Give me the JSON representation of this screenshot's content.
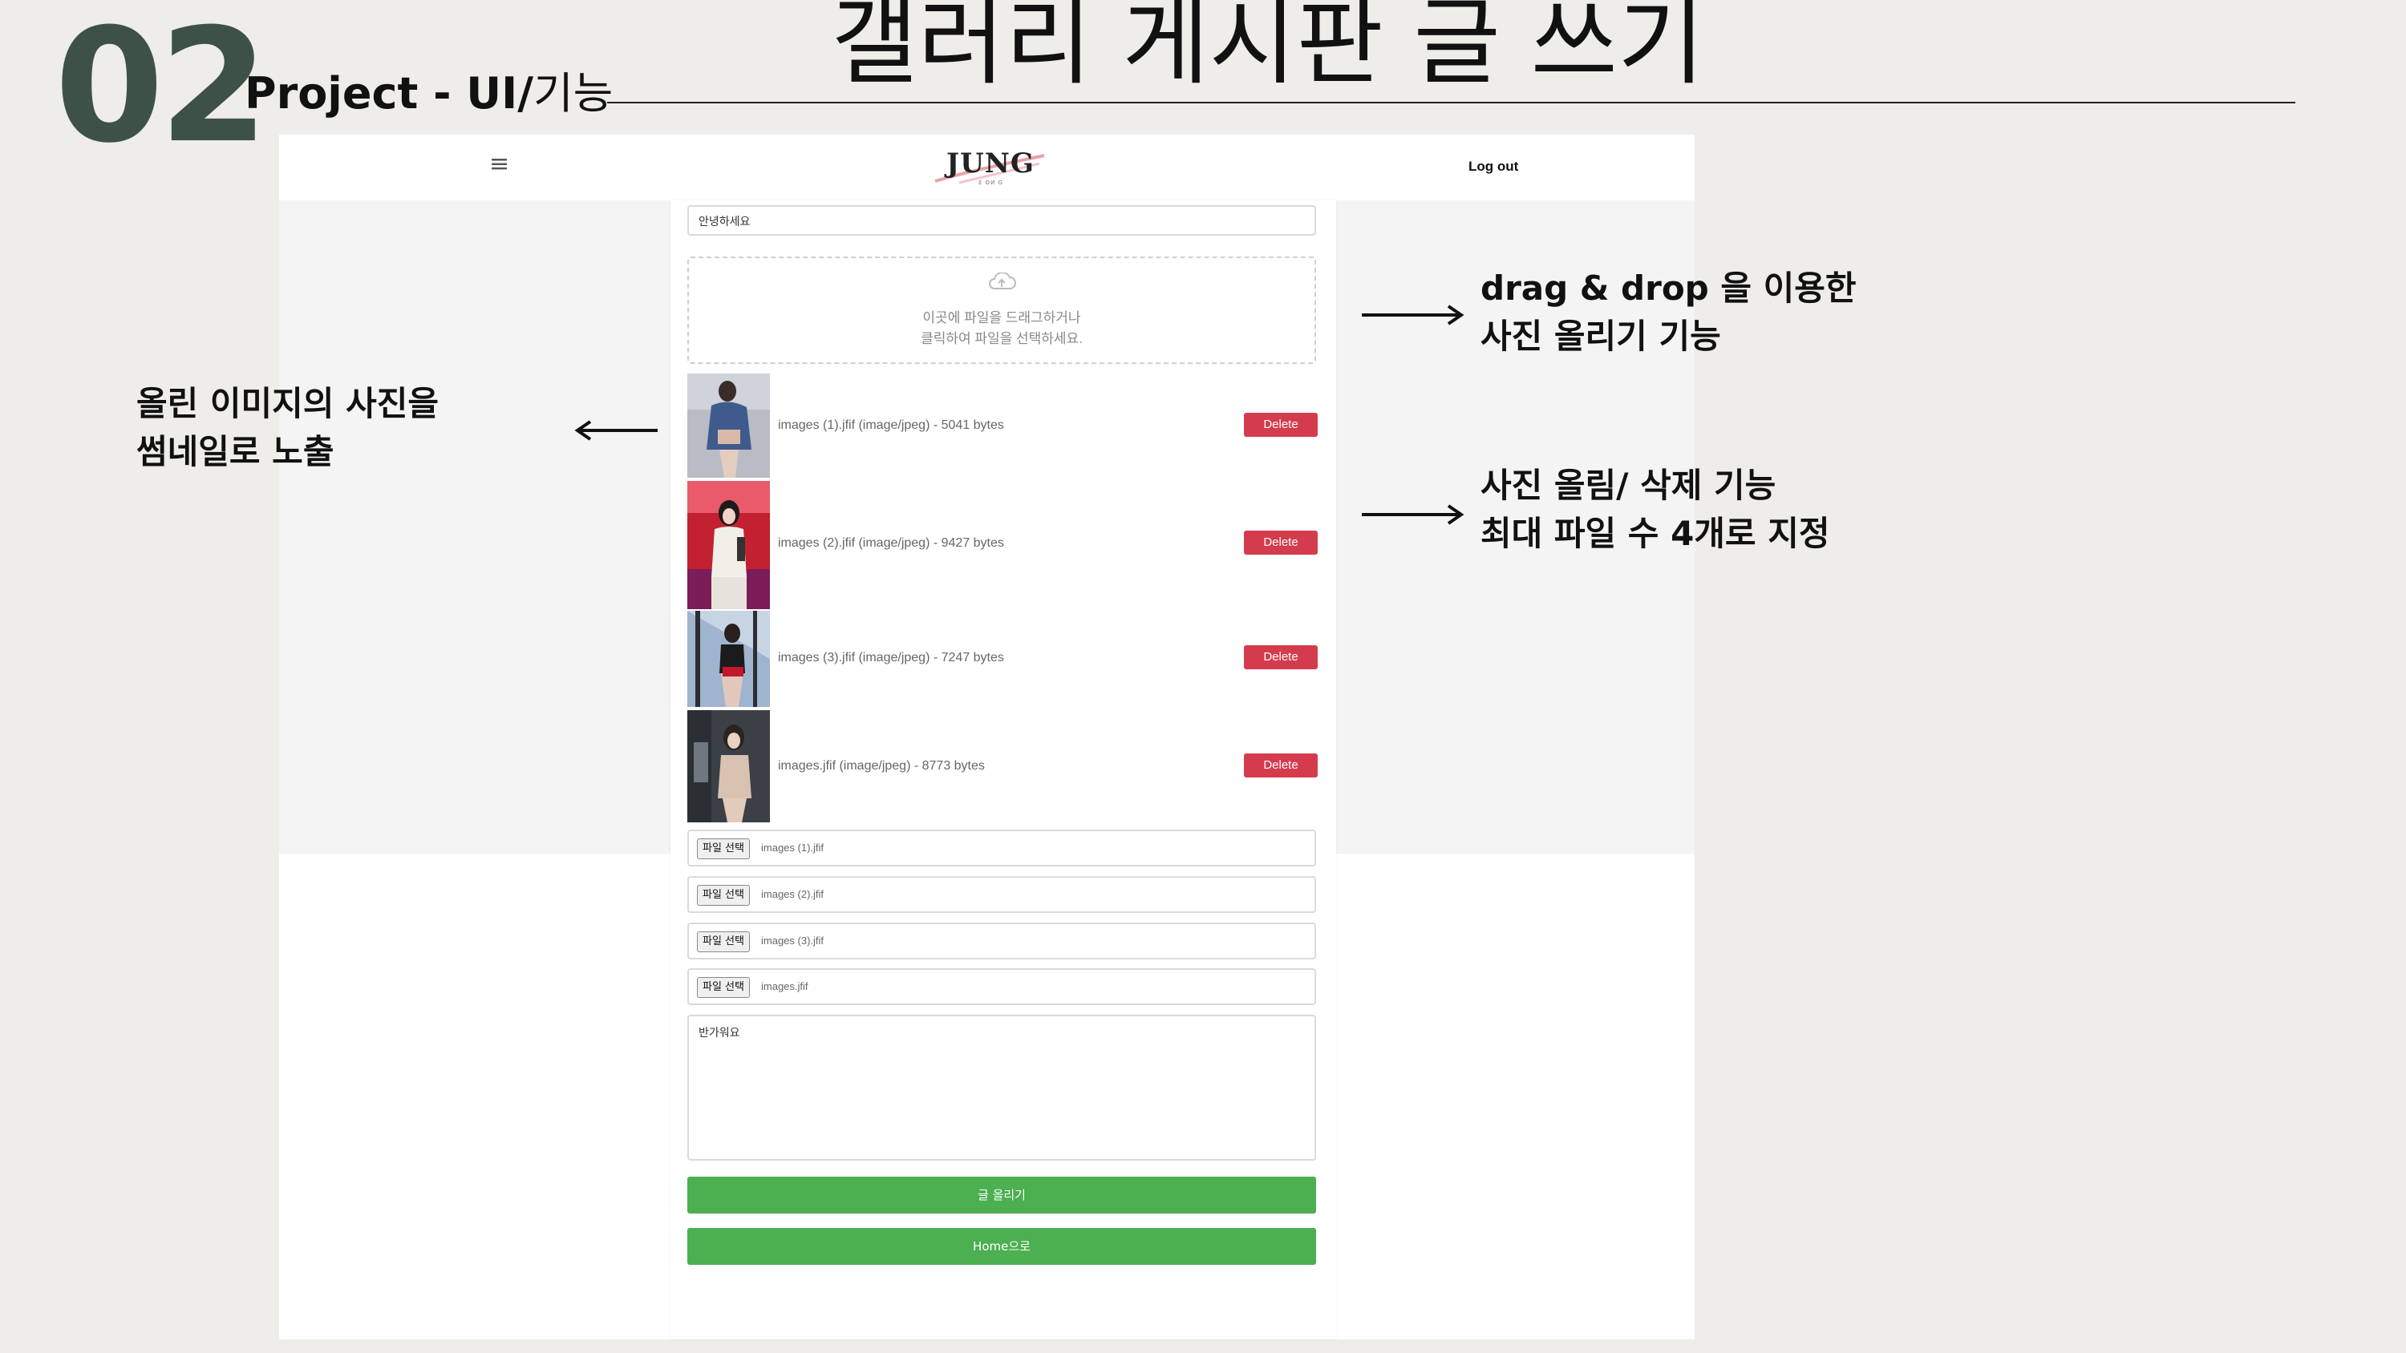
{
  "slide": {
    "number": "02",
    "subtitle_bold": "Project - UI/",
    "subtitle_rest": "기능",
    "title": "갤러리 게시판 글 쓰기"
  },
  "app": {
    "menu_icon": "≡",
    "logo": "JUNG",
    "logo_small": "Ɛ OИ G",
    "logout": "Log out",
    "title_input_value": "안녕하세요",
    "dropzone_line1": "이곳에 파일을 드래그하거나",
    "dropzone_line2": "클릭하여 파일을 선택하세요.",
    "delete_label": "Delete",
    "uploads": [
      {
        "info": "images (1).jfif (image/jpeg) - 5041 bytes"
      },
      {
        "info": "images (2).jfif (image/jpeg) - 9427 bytes"
      },
      {
        "info": "images (3).jfif (image/jpeg) - 7247 bytes"
      },
      {
        "info": "images.jfif (image/jpeg) - 8773 bytes"
      }
    ],
    "choose_file_label": "파일 선택",
    "file_inputs": [
      "images (1).jfif",
      "images (2).jfif",
      "images (3).jfif",
      "images.jfif"
    ],
    "content_value": "반가워요",
    "submit_label": "글 올리기",
    "home_label": "Home으로"
  },
  "annotations": {
    "right_top": [
      "drag & drop 을 이용한",
      "사진 올리기 기능"
    ],
    "right_mid": [
      "사진 올림/ 삭제 기능",
      "최대 파일 수 4개로 지정"
    ],
    "left": [
      "올린 이미지의 사진을",
      "썸네일로 노출"
    ]
  }
}
